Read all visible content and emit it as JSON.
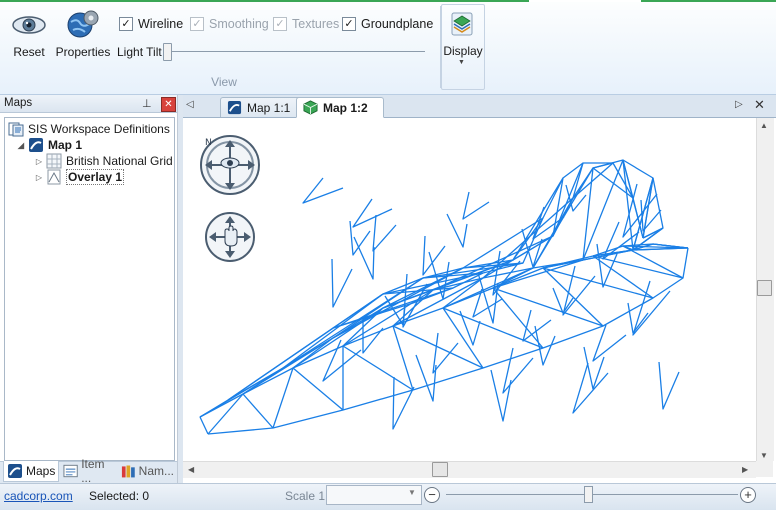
{
  "ribbon": {
    "reset_label": "Reset",
    "properties_label": "Properties",
    "checkboxes": [
      {
        "label": "Wireline",
        "checked": true,
        "enabled": true
      },
      {
        "label": "Smoothing",
        "checked": true,
        "enabled": false
      },
      {
        "label": "Textures",
        "checked": true,
        "enabled": false
      },
      {
        "label": "Groundplane",
        "checked": true,
        "enabled": true
      }
    ],
    "light_tilt_label": "Light Tilt",
    "light_tilt_value": 0,
    "group_label": "View",
    "display_label": "Display"
  },
  "maps_panel": {
    "title": "Maps",
    "pin_icon": "pin-icon",
    "close_icon": "close-icon",
    "tree": {
      "root": "SIS Workspace Definitions",
      "map": "Map 1",
      "children": [
        "British National Grid",
        "Overlay 1"
      ]
    },
    "bottom_tabs": [
      "Maps",
      "Item ...",
      "Nam..."
    ]
  },
  "doc_tabs": {
    "tabs": [
      "Map 1:1",
      "Map 1:2"
    ],
    "active": "Map 1:2"
  },
  "status_bar": {
    "link": "cadcorp.com",
    "selected": "Selected: 0",
    "scale_label": "Scale 1:",
    "scale_value": ""
  },
  "colors": {
    "wireframe": "#1a7fe6",
    "ribbon_accent": "#3aa655",
    "nav_ring": "#4b5d70"
  }
}
